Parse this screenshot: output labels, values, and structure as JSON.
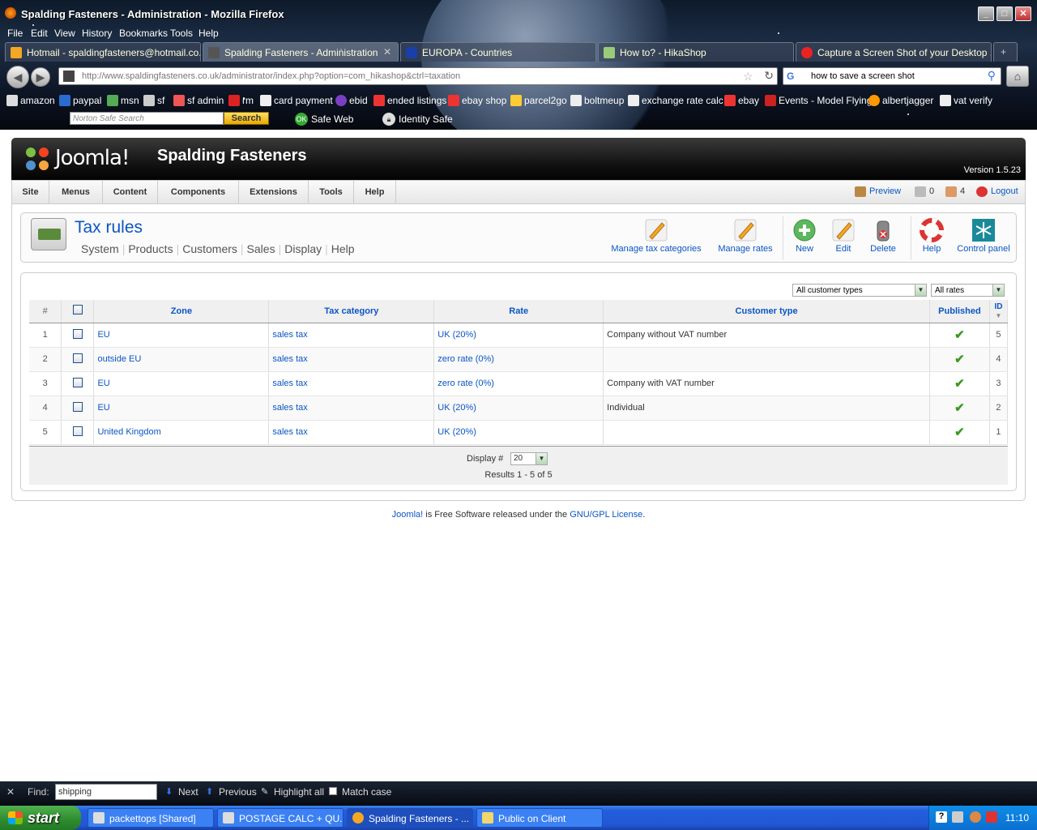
{
  "window": {
    "title": "Spalding Fasteners - Administration - Mozilla Firefox",
    "controls": [
      "_",
      "□",
      "✕"
    ]
  },
  "menubar": [
    "File",
    "Edit",
    "View",
    "History",
    "Bookmarks",
    "Tools",
    "Help"
  ],
  "tabs": [
    {
      "label": "Hotmail - spaldingfasteners@hotmail.co...",
      "active": false
    },
    {
      "label": "Spalding Fasteners - Administration",
      "active": true
    },
    {
      "label": "EUROPA - Countries",
      "active": false
    },
    {
      "label": "How to? - HikaShop",
      "active": false
    },
    {
      "label": "Capture a Screen Shot of your Desktop ...",
      "active": false
    }
  ],
  "urlbar": {
    "url": "http://www.spaldingfasteners.co.uk/administrator/index.php?option=com_hikashop&ctrl=taxation"
  },
  "searchbar": {
    "value": "how to save a screen shot"
  },
  "bookmarks": [
    "amazon",
    "paypal",
    "msn",
    "sf",
    "sf admin",
    "rm",
    "card payment",
    "ebid",
    "ended listings",
    "ebay shop",
    "parcel2go",
    "boltmeup",
    "exchange rate calc",
    "ebay",
    "Events - Model Flying",
    "albertjagger",
    "vat verify"
  ],
  "norton": {
    "search_placeholder": "Norton Safe Search",
    "search_button": "Search",
    "safe_web": "Safe Web",
    "safe_web_badge": "OK",
    "identity_safe": "Identity Safe"
  },
  "joomla": {
    "logo_text": "Joomla!",
    "site_name": "Spalding Fasteners",
    "version": "Version 1.5.23",
    "menu": [
      "Site",
      "Menus",
      "Content",
      "Components",
      "Extensions",
      "Tools",
      "Help"
    ],
    "status": {
      "preview": "Preview",
      "messages": "0",
      "users": "4",
      "logout": "Logout"
    }
  },
  "toolbar": {
    "title": "Tax rules",
    "submenu": [
      "System",
      "Products",
      "Customers",
      "Sales",
      "Display",
      "Help"
    ],
    "buttons": {
      "manage_tax_categories": "Manage tax categories",
      "manage_rates": "Manage rates",
      "new": "New",
      "edit": "Edit",
      "delete": "Delete",
      "help": "Help",
      "control_panel": "Control panel"
    }
  },
  "filters": {
    "customer_types": "All customer types",
    "rates": "All rates"
  },
  "table": {
    "headers": {
      "num": "#",
      "zone": "Zone",
      "tax_category": "Tax category",
      "rate": "Rate",
      "customer_type": "Customer type",
      "published": "Published",
      "id": "ID"
    },
    "rows": [
      {
        "num": "1",
        "zone": "EU",
        "tax_category": "sales tax",
        "rate": "UK (20%)",
        "customer_type": "Company without VAT number",
        "published": true,
        "id": "5"
      },
      {
        "num": "2",
        "zone": "outside EU",
        "tax_category": "sales tax",
        "rate": "zero rate (0%)",
        "customer_type": "",
        "published": true,
        "id": "4"
      },
      {
        "num": "3",
        "zone": "EU",
        "tax_category": "sales tax",
        "rate": "zero rate (0%)",
        "customer_type": "Company with VAT number",
        "published": true,
        "id": "3"
      },
      {
        "num": "4",
        "zone": "EU",
        "tax_category": "sales tax",
        "rate": "UK (20%)",
        "customer_type": "Individual",
        "published": true,
        "id": "2"
      },
      {
        "num": "5",
        "zone": "United Kingdom",
        "tax_category": "sales tax",
        "rate": "UK (20%)",
        "customer_type": "",
        "published": true,
        "id": "1"
      }
    ]
  },
  "pagination": {
    "display_label": "Display #",
    "display_value": "20",
    "results": "Results 1 - 5 of 5"
  },
  "footer": {
    "joomla_link": "Joomla!",
    "text": " is Free Software released under the ",
    "license_link": "GNU/GPL License",
    "end": "."
  },
  "findbar": {
    "label": "Find:",
    "value": "shipping",
    "next": "Next",
    "previous": "Previous",
    "highlight": "Highlight all",
    "match_case": "Match case"
  },
  "taskbar": {
    "start": "start",
    "tasks": [
      {
        "label": "packettops [Shared]",
        "active": false
      },
      {
        "label": "POSTAGE CALC + QU...",
        "active": false
      },
      {
        "label": "Spalding Fasteners - ...",
        "active": true
      },
      {
        "label": "Public on Client",
        "active": false
      }
    ],
    "clock": "11:10"
  }
}
